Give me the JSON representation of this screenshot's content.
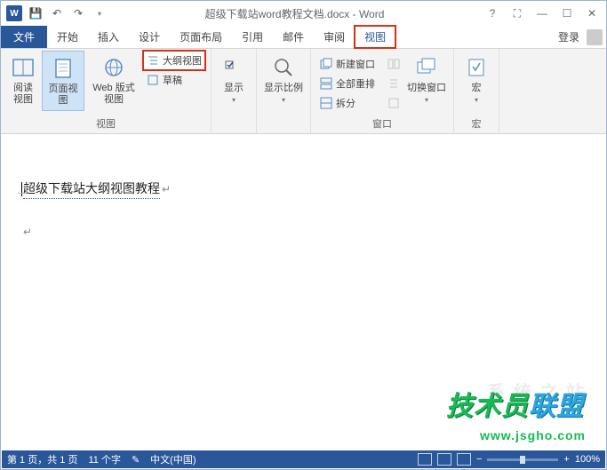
{
  "title": "超级下载站word教程文档.docx - Word",
  "qat": {
    "save": "💾",
    "undo": "↶",
    "redo": "↷",
    "customize": "▾"
  },
  "win": {
    "help": "?",
    "ribbon_opts": "⛶",
    "min": "—",
    "max": "☐",
    "close": "✕"
  },
  "tabs": {
    "file": "文件",
    "home": "开始",
    "insert": "插入",
    "design": "设计",
    "layout": "页面布局",
    "references": "引用",
    "mailings": "邮件",
    "review": "审阅",
    "view": "视图"
  },
  "login": "登录",
  "ribbon": {
    "views_group": "视图",
    "read_view": "阅读\n视图",
    "page_view": "页面视图",
    "web_view": "Web 版式视图",
    "outline_view": "大纲视图",
    "draft_view": "草稿",
    "show_group_btn": "显示",
    "zoom_group_btn": "显示比例",
    "window_group": "窗口",
    "new_window": "新建窗口",
    "arrange_all": "全部重排",
    "split": "拆分",
    "switch_windows": "切换窗口",
    "macros_group": "宏",
    "macros_btn": "宏"
  },
  "document": {
    "text": "超级下载站大纲视图教程"
  },
  "status": {
    "page": "第 1 页，共 1 页",
    "words": "11 个字",
    "lang": "中文(中国)",
    "zoom": "100%"
  },
  "watermark": {
    "main": "技术员联盟",
    "url": "www.jsgho.com",
    "faint": "系 统 之 站"
  }
}
